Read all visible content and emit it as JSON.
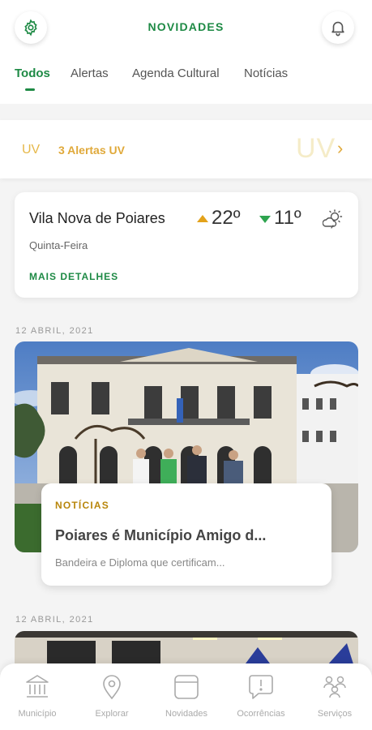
{
  "header": {
    "title": "NOVIDADES",
    "settings_icon": "gear-icon",
    "bell_icon": "bell-icon"
  },
  "tabs": [
    {
      "label": "Todos",
      "active": true
    },
    {
      "label": "Alertas",
      "active": false
    },
    {
      "label": "Agenda Cultural",
      "active": false
    },
    {
      "label": "Notícias",
      "active": false
    }
  ],
  "uv_alert": {
    "small_label": "UV",
    "text": "3 Alertas UV",
    "big_label": "UV",
    "chevron": "›"
  },
  "weather": {
    "city": "Vila Nova de Poiares",
    "temp_max": "22º",
    "temp_min": "11º",
    "day": "Quinta-Feira",
    "more_label": "MAIS DETALHES",
    "icon": "sun-cloud-icon"
  },
  "feed": [
    {
      "date": "12 ABRIL, 2021",
      "category": "NOTÍCIAS",
      "title": "Poiares é Município Amigo d...",
      "description": "Bandeira e Diploma que certificam..."
    },
    {
      "date": "12 ABRIL, 2021"
    }
  ],
  "bottom_nav": [
    {
      "label": "Município",
      "icon": "bank-icon"
    },
    {
      "label": "Explorar",
      "icon": "map-pin-icon"
    },
    {
      "label": "Novidades",
      "icon": "news-icon"
    },
    {
      "label": "Ocorrências",
      "icon": "alert-bubble-icon"
    },
    {
      "label": "Serviços",
      "icon": "services-icon"
    }
  ],
  "colors": {
    "primary_green": "#1e8a45",
    "uv_amber": "#e0a93a",
    "temp_up": "#e3a21a",
    "temp_down": "#2ea44f"
  }
}
